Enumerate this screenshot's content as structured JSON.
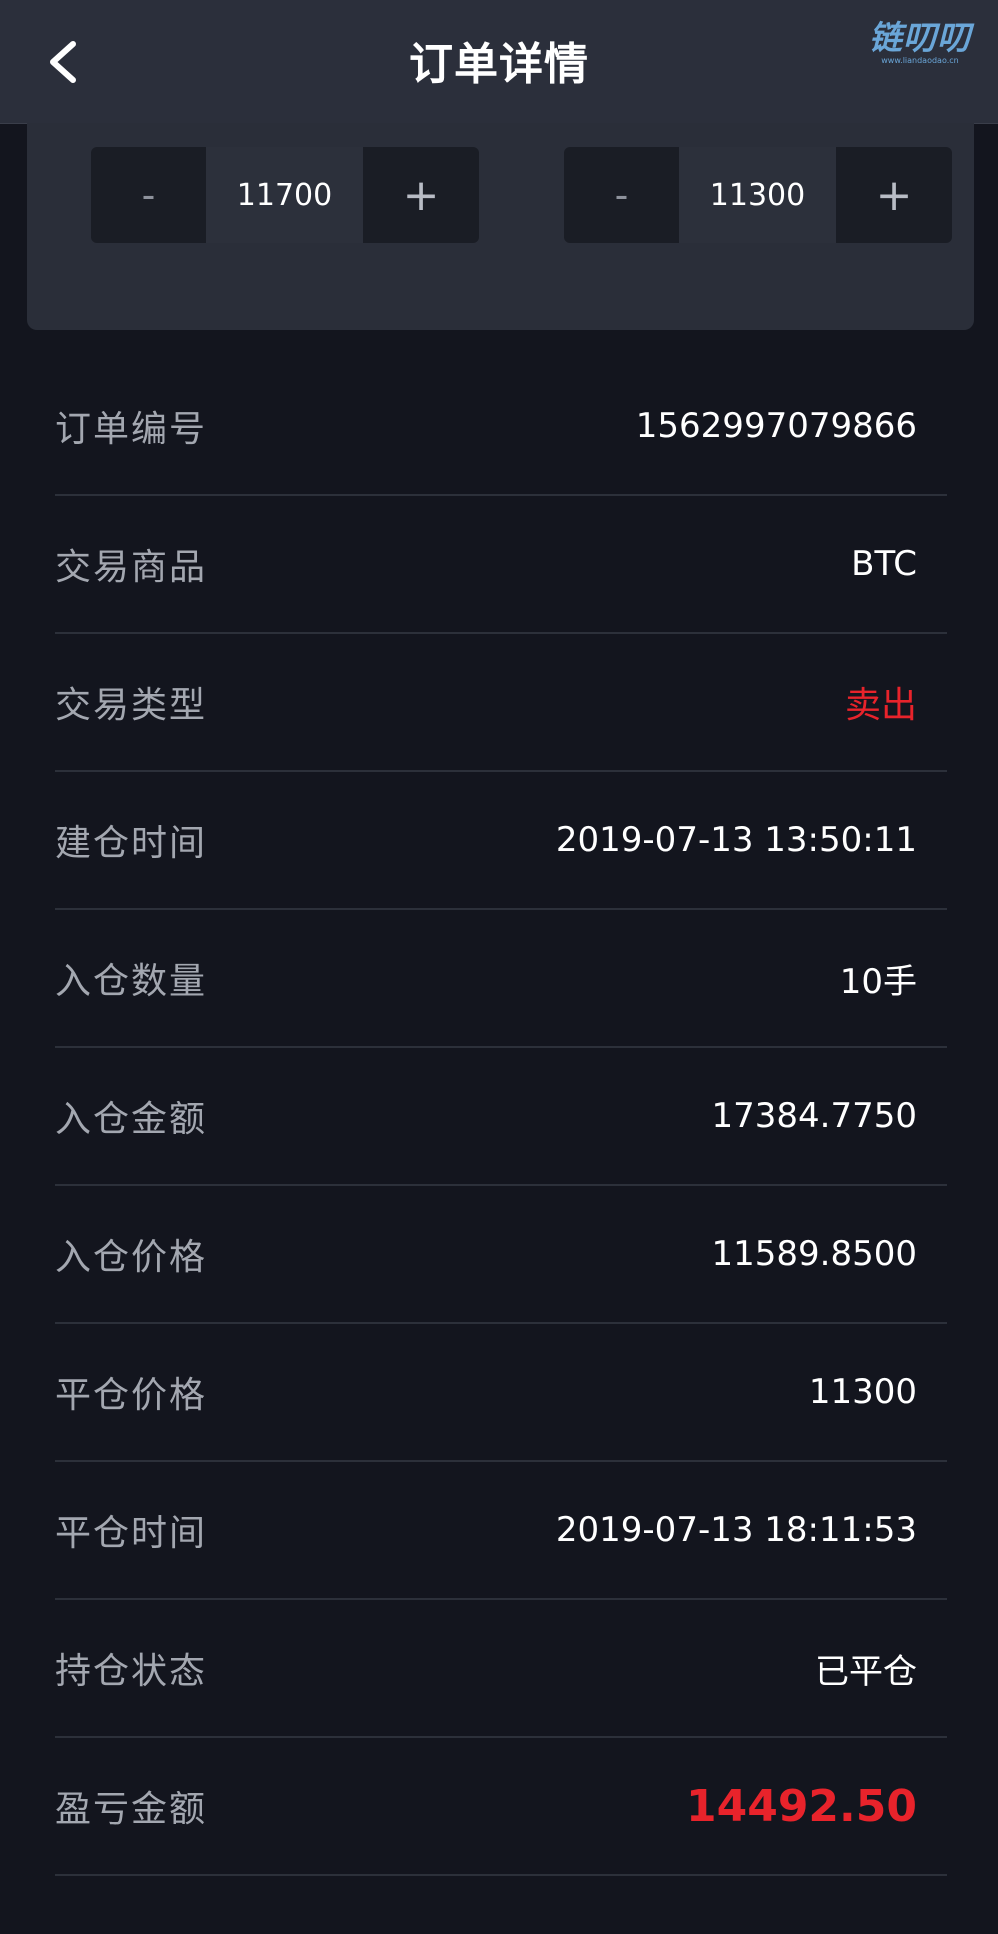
{
  "header": {
    "title": "订单详情",
    "watermark": "链叨叨",
    "watermark_sub": "www.liandaodao.cn"
  },
  "steppers": {
    "take_profit": {
      "minus": "-",
      "value": "11700",
      "plus": "+"
    },
    "stop_loss": {
      "minus": "-",
      "value": "11300",
      "plus": "+"
    }
  },
  "details": [
    {
      "label": "订单编号",
      "value": "1562997079866"
    },
    {
      "label": "交易商品",
      "value": "BTC"
    },
    {
      "label": "交易类型",
      "value": "卖出"
    },
    {
      "label": "建仓时间",
      "value": "2019-07-13 13:50:11"
    },
    {
      "label": "入仓数量",
      "value": "10手"
    },
    {
      "label": "入仓金额",
      "value": "17384.7750"
    },
    {
      "label": "入仓价格",
      "value": "11589.8500"
    },
    {
      "label": "平仓价格",
      "value": "11300"
    },
    {
      "label": "平仓时间",
      "value": "2019-07-13 18:11:53"
    },
    {
      "label": "持仓状态",
      "value": "已平仓"
    },
    {
      "label": "盈亏金额",
      "value": "14492.50"
    }
  ],
  "colors": {
    "background": "#13151e",
    "header": "#2b2f3b",
    "panel": "#2a2e39",
    "sell_red": "#e8232b",
    "label_gray": "#a3a7b0"
  },
  "icons": {
    "back": "chevron-left-icon"
  }
}
